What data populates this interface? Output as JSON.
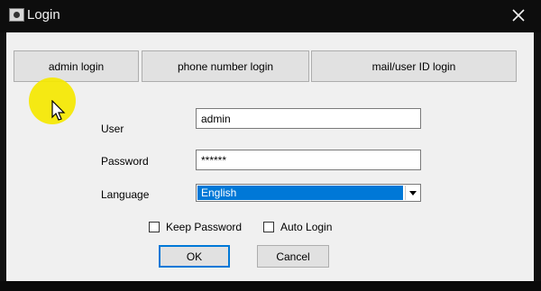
{
  "window": {
    "title": "Login",
    "app_icon": "camera-app-icon",
    "close_icon": "close-icon"
  },
  "tabs": [
    {
      "label": "admin login"
    },
    {
      "label": "phone number login"
    },
    {
      "label": "mail/user ID login"
    }
  ],
  "form": {
    "user_label": "User",
    "user_value": "admin",
    "password_label": "Password",
    "password_value": "******",
    "language_label": "Language",
    "language_value": "English",
    "language_arrow_icon": "chevron-down-icon"
  },
  "options": {
    "keep_password_label": "Keep Password",
    "keep_password_checked": false,
    "auto_login_label": "Auto Login",
    "auto_login_checked": false
  },
  "buttons": {
    "ok_label": "OK",
    "cancel_label": "Cancel"
  },
  "colors": {
    "titlebar": "#0d0d0d",
    "client": "#f0f0f0",
    "selection": "#0078d7",
    "cursor_highlight": "#f5e800"
  }
}
